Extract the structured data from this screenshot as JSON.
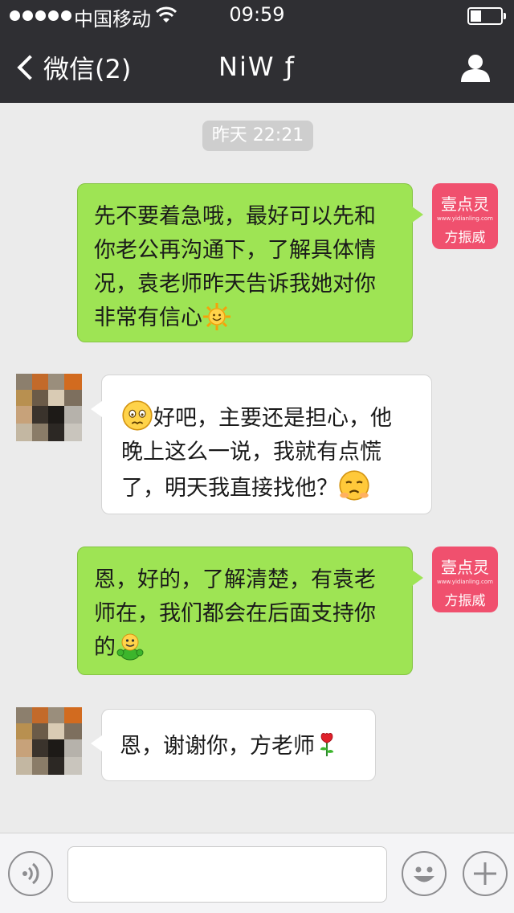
{
  "status_bar": {
    "carrier": "中国移动",
    "time": "09:59",
    "battery_level": 0.35,
    "signal_bars": 5
  },
  "nav": {
    "back_label": "微信(2)",
    "title": "NiW ƒ",
    "back_icon": "chevron-left-icon",
    "profile_icon": "person-icon"
  },
  "timestamp": "昨天 22:21",
  "brand_avatar": {
    "name": "壹点灵",
    "url": "www.yidianling.com",
    "person": "方振威",
    "color": "#f0506e"
  },
  "messages": [
    {
      "direction": "outgoing",
      "lines": [
        "先不要着急哦，最好可以先和",
        "你老公再沟通下，了解具体情",
        "况，袁老师昨天告诉我她对你",
        "非常有信心"
      ],
      "trailing_emoji": "sun-emoji"
    },
    {
      "direction": "incoming",
      "lines": [
        "好吧，主要还是担心，他",
        "晚上这么一说，我就有点慌",
        "了，明天我直接找他？"
      ],
      "leading_emoji": "worried-face-emoji",
      "trailing_emoji": "sad-face-emoji"
    },
    {
      "direction": "outgoing",
      "lines": [
        "恩，好的，了解清楚，有袁老",
        "师在，我们都会在后面支持你",
        "的"
      ],
      "trailing_emoji": "cheering-person-emoji"
    },
    {
      "direction": "incoming",
      "lines": [
        "恩，谢谢你，方老师"
      ],
      "trailing_emoji": "rose-emoji"
    }
  ],
  "input_bar": {
    "voice_icon": "voice-icon",
    "emoji_icon": "smiley-icon",
    "add_icon": "plus-icon",
    "placeholder": ""
  },
  "colors": {
    "bar": "#2f2f33",
    "background": "#ebebeb",
    "outgoing_bubble": "#9ee454",
    "incoming_bubble": "#ffffff"
  }
}
